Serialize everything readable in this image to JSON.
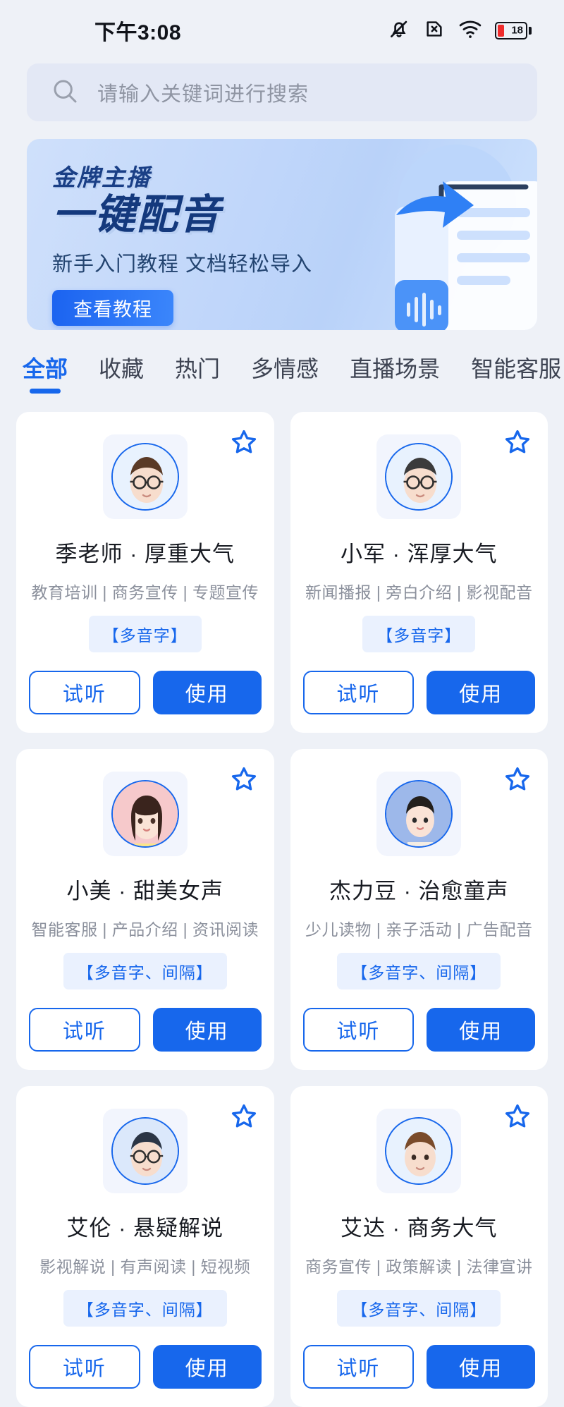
{
  "status_bar": {
    "time": "下午3:08",
    "icons": [
      "mute-bell-icon",
      "sim-x-icon",
      "wifi-icon",
      "battery-icon"
    ],
    "battery_level": "18"
  },
  "search": {
    "placeholder": "请输入关键词进行搜索",
    "icon": "search-icon"
  },
  "banner": {
    "kicker": "金牌主播",
    "title": "一键配音",
    "subtitle": "新手入门教程 文档轻松导入",
    "cta_label": "查看教程",
    "art": "document-import-illustration"
  },
  "tabs": [
    {
      "label": "全部",
      "active": true
    },
    {
      "label": "收藏",
      "active": false
    },
    {
      "label": "热门",
      "active": false
    },
    {
      "label": "多情感",
      "active": false
    },
    {
      "label": "直播场景",
      "active": false
    },
    {
      "label": "智能客服",
      "active": false
    }
  ],
  "colors": {
    "accent": "#1767ec",
    "page_bg": "#eef1f7",
    "card_bg": "#ffffff",
    "badge_bg": "#eaf1fe",
    "muted_text": "#8b909c"
  },
  "actions": {
    "preview_label": "试听",
    "use_label": "使用",
    "favorite_icon": "star-outline-icon"
  },
  "voices": [
    {
      "name": "季老师 · 厚重大气",
      "desc": "教育培训 | 商务宣传 | 专题宣传",
      "badge": "【多音字】",
      "avatar": "male-glasses-brown-hair"
    },
    {
      "name": "小军 · 浑厚大气",
      "desc": "新闻播报 | 旁白介绍 | 影视配音",
      "badge": "【多音字】",
      "avatar": "male-glasses-short-hair"
    },
    {
      "name": "小美 · 甜美女声",
      "desc": "智能客服 | 产品介绍 | 资讯阅读",
      "badge": "【多音字、间隔】",
      "avatar": "female-long-hair-pink"
    },
    {
      "name": "杰力豆 · 治愈童声",
      "desc": "少儿读物 | 亲子活动 | 广告配音",
      "badge": "【多音字、间隔】",
      "avatar": "boy-short-hair-blue"
    },
    {
      "name": "艾伦 · 悬疑解说",
      "desc": "影视解说 | 有声阅读 | 短视频",
      "badge": "【多音字、间隔】",
      "avatar": "male-glasses-dark-hair"
    },
    {
      "name": "艾达 · 商务大气",
      "desc": "商务宣传 | 政策解读 | 法律宣讲",
      "badge": "【多音字、间隔】",
      "avatar": "male-brown-hair"
    }
  ]
}
